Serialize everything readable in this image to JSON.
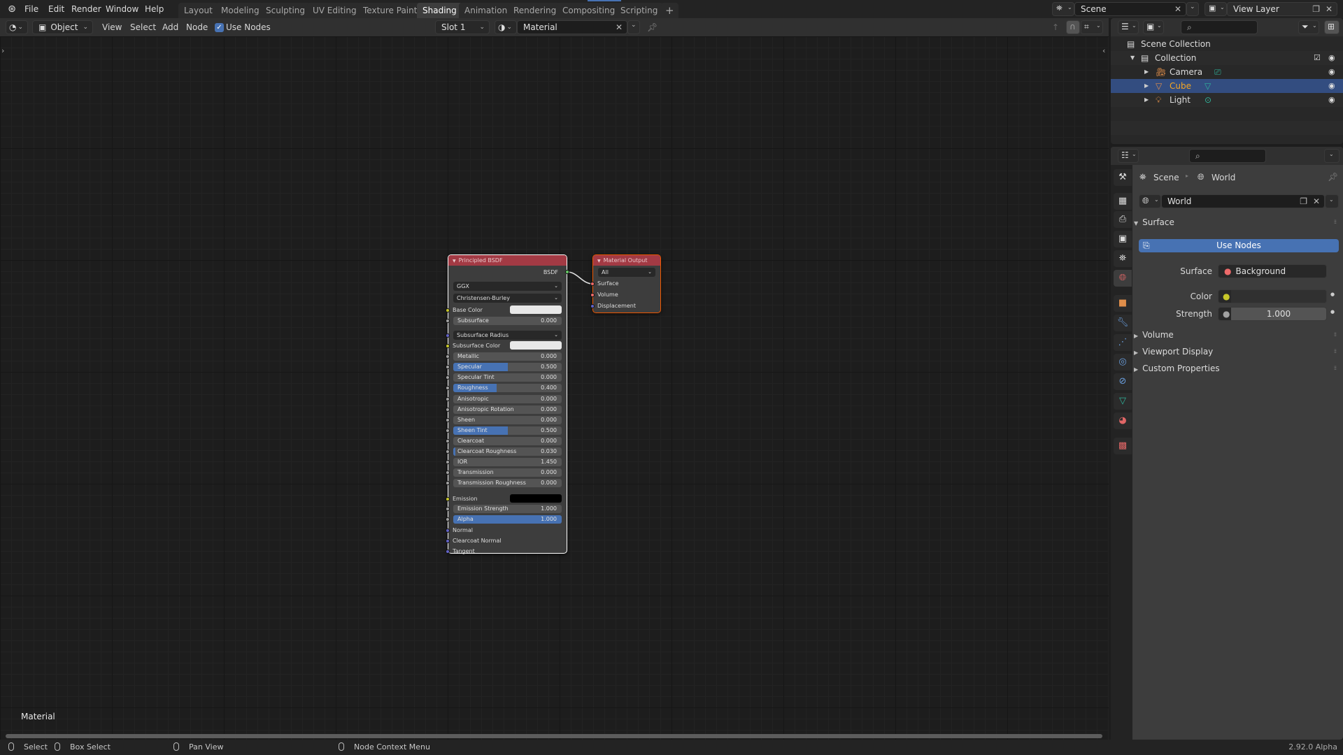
{
  "topbar": {
    "menus": [
      "File",
      "Edit",
      "Render",
      "Window",
      "Help"
    ],
    "workspaces": [
      "Layout",
      "Modeling",
      "Sculpting",
      "UV Editing",
      "Texture Paint",
      "Shading",
      "Animation",
      "Rendering",
      "Compositing",
      "Scripting"
    ],
    "active_workspace": "Shading",
    "add_tab": "+",
    "scene": "Scene",
    "view_layer": "View Layer"
  },
  "editor_header": {
    "mode": "Object",
    "menus": [
      "View",
      "Select",
      "Add",
      "Node"
    ],
    "use_nodes_label": "Use Nodes",
    "use_nodes_checked": true,
    "slot": "Slot 1",
    "material": "Material"
  },
  "node_editor": {
    "context_label": "Material",
    "nodes": {
      "principled": {
        "title": "Principled BSDF",
        "output": "BSDF",
        "distribution": "GGX",
        "subsurface_method": "Christensen-Burley",
        "base_color_label": "Base Color",
        "subsurface_radius_label": "Subsurface Radius",
        "subsurface_color_label": "Subsurface Color",
        "emission_label": "Emission",
        "normal_label": "Normal",
        "clearcoat_normal_label": "Clearcoat Normal",
        "tangent_label": "Tangent",
        "sliders": [
          {
            "label": "Subsurface",
            "value": "0.000",
            "fraction": 0
          },
          {
            "label": "Metallic",
            "value": "0.000",
            "fraction": 0
          },
          {
            "label": "Specular",
            "value": "0.500",
            "fraction": 0.5
          },
          {
            "label": "Specular Tint",
            "value": "0.000",
            "fraction": 0
          },
          {
            "label": "Roughness",
            "value": "0.400",
            "fraction": 0.4
          },
          {
            "label": "Anisotropic",
            "value": "0.000",
            "fraction": 0
          },
          {
            "label": "Anisotropic Rotation",
            "value": "0.000",
            "fraction": 0
          },
          {
            "label": "Sheen",
            "value": "0.000",
            "fraction": 0
          },
          {
            "label": "Sheen Tint",
            "value": "0.500",
            "fraction": 0.5
          },
          {
            "label": "Clearcoat",
            "value": "0.000",
            "fraction": 0
          },
          {
            "label": "Clearcoat Roughness",
            "value": "0.030",
            "fraction": 0.03
          },
          {
            "label": "IOR",
            "value": "1.450",
            "fraction": 0
          },
          {
            "label": "Transmission",
            "value": "0.000",
            "fraction": 0
          },
          {
            "label": "Transmission Roughness",
            "value": "0.000",
            "fraction": 0
          },
          {
            "label": "Emission Strength",
            "value": "1.000",
            "fraction": 0
          },
          {
            "label": "Alpha",
            "value": "1.000",
            "fraction": 1
          }
        ]
      },
      "output": {
        "title": "Material Output",
        "target": "All",
        "inputs": [
          "Surface",
          "Volume",
          "Displacement"
        ]
      }
    }
  },
  "outliner": {
    "root": "Scene Collection",
    "collection": "Collection",
    "items": [
      {
        "name": "Camera",
        "selected": false
      },
      {
        "name": "Cube",
        "selected": true
      },
      {
        "name": "Light",
        "selected": false
      }
    ]
  },
  "properties": {
    "breadcrumb": [
      "Scene",
      "World"
    ],
    "world_name": "World",
    "surface_panel": "Surface",
    "use_nodes_button": "Use Nodes",
    "surface_label": "Surface",
    "surface_value": "Background",
    "color_label": "Color",
    "strength_label": "Strength",
    "strength_value": "1.000",
    "collapsed_panels": [
      "Volume",
      "Viewport Display",
      "Custom Properties"
    ]
  },
  "statusbar": {
    "hints": [
      "Select",
      "Box Select",
      "Pan View",
      "Node Context Menu"
    ],
    "version": "2.92.0 Alpha"
  },
  "colors": {
    "accent": "#4772b3",
    "node_header": "#a33a44",
    "selected_row": "#334d80",
    "active_text": "#f5a623"
  }
}
